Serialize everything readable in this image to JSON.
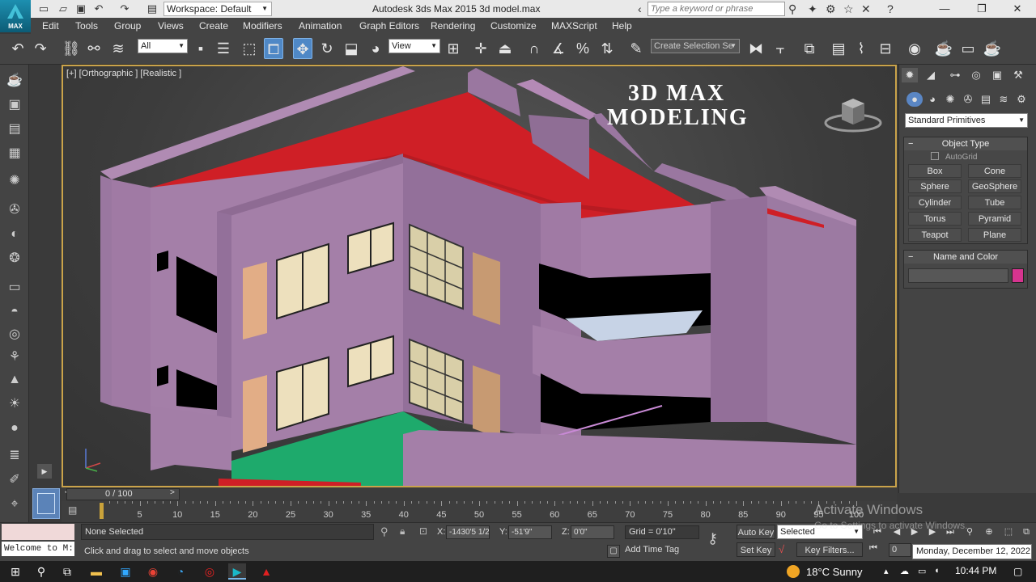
{
  "titlebar": {
    "app_icon_label": "MAX",
    "workspace": "Workspace: Default",
    "title": "Autodesk 3ds Max  2015     3d model.max",
    "search_placeholder": "Type a keyword or phrase"
  },
  "menu": [
    "Edit",
    "Tools",
    "Group",
    "Views",
    "Create",
    "Modifiers",
    "Animation",
    "Graph Editors",
    "Rendering",
    "Customize",
    "MAXScript",
    "Help"
  ],
  "toolbar": {
    "selection_filter": "All",
    "reference_coord": "View",
    "named_selection": "Create Selection Se"
  },
  "viewport": {
    "label": "[+] [Orthographic ] [Realistic ]",
    "heading_line1": "3D MAX",
    "heading_line2": "MODELING",
    "colors": {
      "wall": "#a07aa4",
      "roof": "#d21e26",
      "floor": "#1eaa6c",
      "highlight": "#caa34a"
    }
  },
  "command_panel": {
    "category": "Standard Primitives",
    "object_type_title": "Object Type",
    "autogrid": "AutoGrid",
    "buttons": [
      "Box",
      "Cone",
      "Sphere",
      "GeoSphere",
      "Cylinder",
      "Tube",
      "Torus",
      "Pyramid",
      "Teapot",
      "Plane"
    ],
    "name_color_title": "Name and Color",
    "object_color": "#d6348f"
  },
  "timeline": {
    "frame_label": "0 / 100",
    "ticks": [
      "5",
      "10",
      "15",
      "20",
      "25",
      "30",
      "35",
      "40",
      "45",
      "50",
      "55",
      "60",
      "65",
      "70",
      "75",
      "80",
      "85",
      "90",
      "95",
      "100"
    ]
  },
  "statusbar": {
    "welcome": "Welcome to M:",
    "selection": "None Selected",
    "prompt": "Click and drag to select and move objects",
    "x_label": "X:",
    "x_value": "-1430'5 1/2",
    "y_label": "Y:",
    "y_value": "-51'9\"",
    "z_label": "Z:",
    "z_value": "0'0\"",
    "grid": "Grid = 0'10\"",
    "add_time_tag": "Add Time Tag",
    "auto_key": "Auto Key",
    "set_key": "Set Key",
    "key_mode": "Selected",
    "key_filters": "Key Filters...",
    "frame": "0"
  },
  "overlay": {
    "activate_title": "Activate Windows",
    "activate_sub": "Go to Settings to activate Windows.",
    "date_tooltip": "Monday, December 12, 2022"
  },
  "taskbar": {
    "weather": "18°C  Sunny",
    "time": "10:44 PM"
  }
}
